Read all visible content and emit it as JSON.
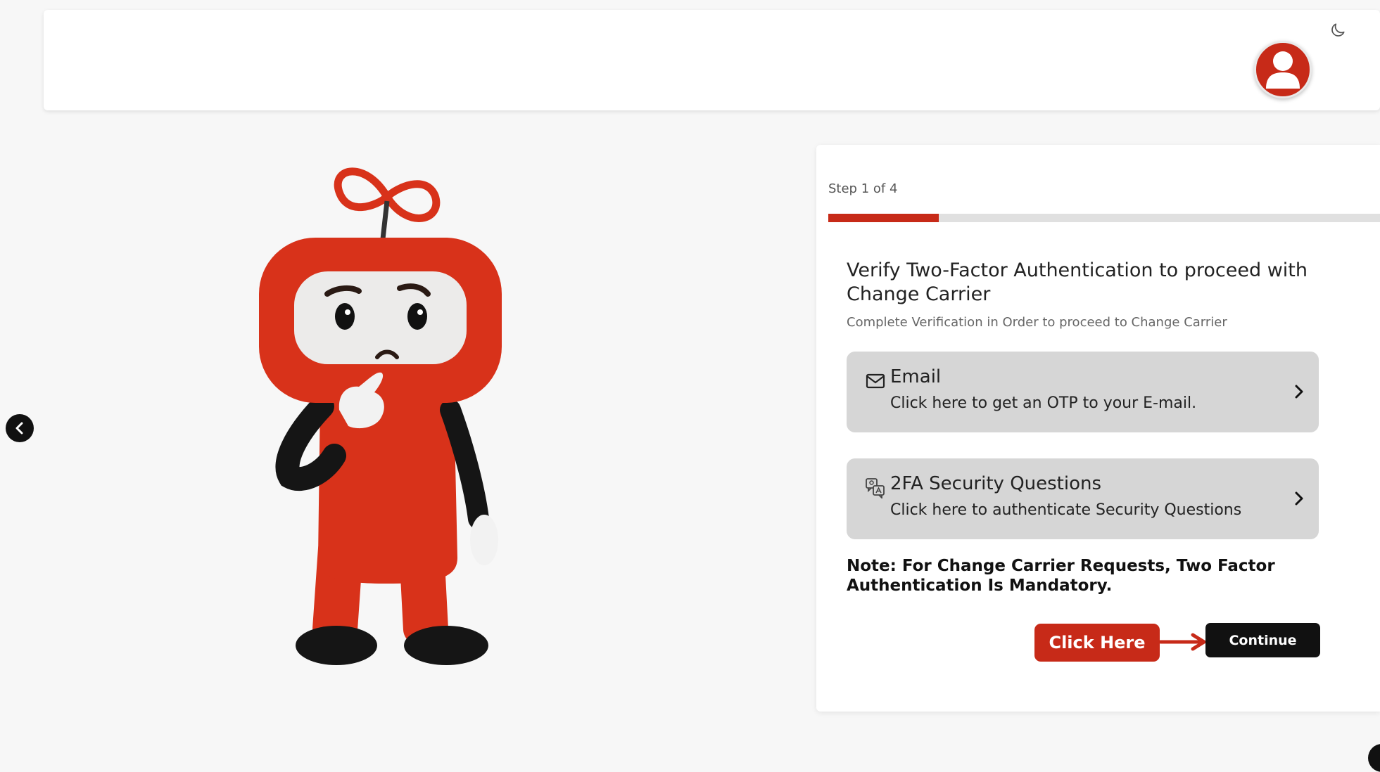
{
  "header": {
    "theme_icon": "moon-icon",
    "avatar_icon": "user-icon"
  },
  "nav": {
    "back_icon": "chevron-left-icon"
  },
  "wizard": {
    "step_label": "Step 1 of 4",
    "progress": 0.2,
    "heading": "Verify Two-Factor Authentication to proceed with Change Carrier",
    "subheading": "Complete Verification in Order to proceed to Change Carrier",
    "options": [
      {
        "icon": "mail-icon",
        "title": "Email",
        "description": "Click here to get an OTP to your E-mail."
      },
      {
        "icon": "security-questions-icon",
        "title": "2FA Security Questions",
        "description": "Click here to authenticate Security Questions"
      }
    ],
    "note": "Note: For Change Carrier Requests, Two Factor Authentication Is Mandatory.",
    "callout_label": "Click Here",
    "continue_label": "Continue"
  },
  "colors": {
    "accent": "#c72a18",
    "button_dark": "#111111",
    "option_bg": "#d6d6d6",
    "page_bg": "#f7f7f7"
  }
}
